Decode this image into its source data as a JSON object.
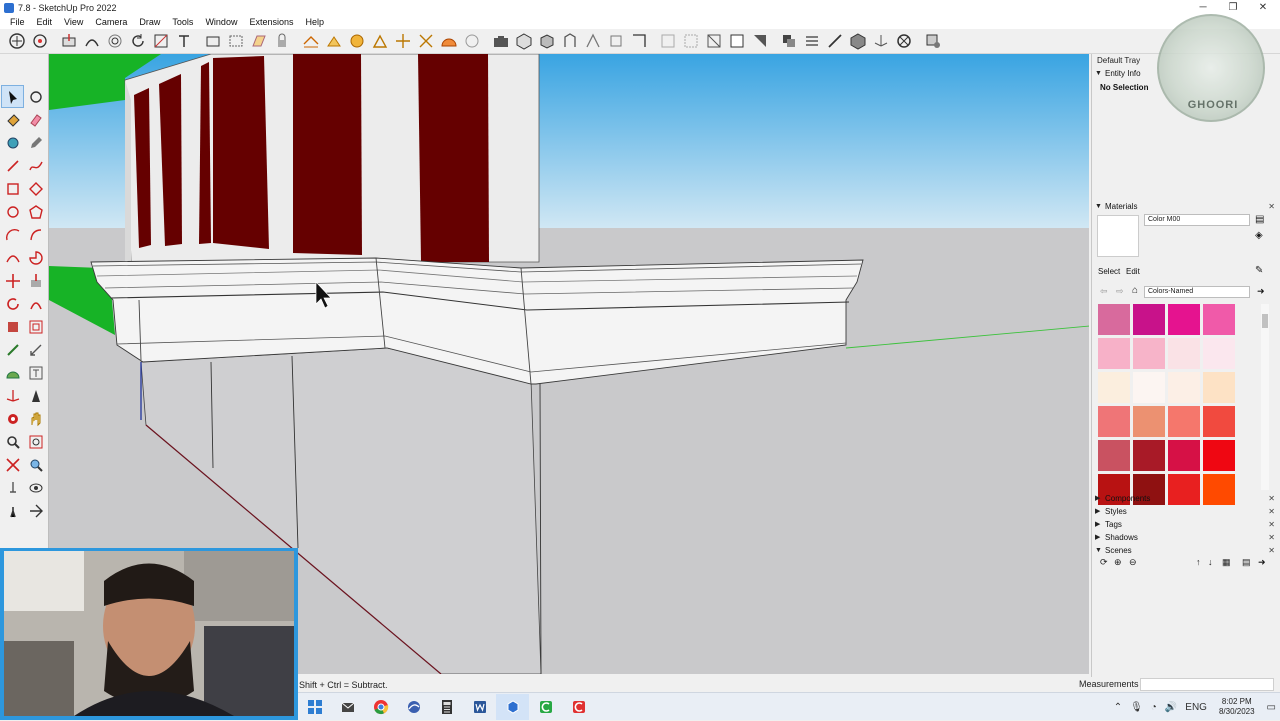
{
  "window": {
    "title": "7.8 - SketchUp Pro 2022",
    "minimize": "─",
    "maximize": "❐",
    "close": "✕"
  },
  "menu": [
    "File",
    "Edit",
    "View",
    "Camera",
    "Draw",
    "Tools",
    "Window",
    "Extensions",
    "Help"
  ],
  "tray": {
    "title": "Default Tray",
    "entity_info": "Entity Info",
    "selection": "No Selection",
    "materials": "Materials",
    "material_name": "Color M00",
    "tab_select": "Select",
    "tab_edit": "Edit",
    "library": "Colors-Named",
    "panels": [
      "Components",
      "Styles",
      "Tags",
      "Shadows",
      "Scenes"
    ]
  },
  "swatches": [
    "#d86a9d",
    "#c8128a",
    "#e5138f",
    "#f05aa9",
    "#f7b1c8",
    "#f7b4c9",
    "#fae2e6",
    "#fbe7ee",
    "#fbeede",
    "#fcf5f2",
    "#fcefe6",
    "#fde2c5",
    "#ef7577",
    "#ec9171",
    "#f5776c",
    "#f14a3f",
    "#c95261",
    "#a81a27",
    "#d61146",
    "#ef0712",
    "#b81212",
    "#8f1111",
    "#e82020",
    "#ff4a00"
  ],
  "status": {
    "hint": "Shift + Ctrl = Subtract.",
    "measurements_label": "Measurements",
    "measurements_value": ""
  },
  "taskbar": {
    "lang": "ENG",
    "time": "8:02 PM",
    "date": "8/30/2023"
  },
  "logo": {
    "text": "GHOORI"
  },
  "colors": {
    "sky_top": "#39a4e2",
    "sky_bottom": "#d2e8f4",
    "ground": "#c9c9cb",
    "panel_red": "#650000",
    "green": "#17b326",
    "webcam_border": "#2d97dd"
  }
}
